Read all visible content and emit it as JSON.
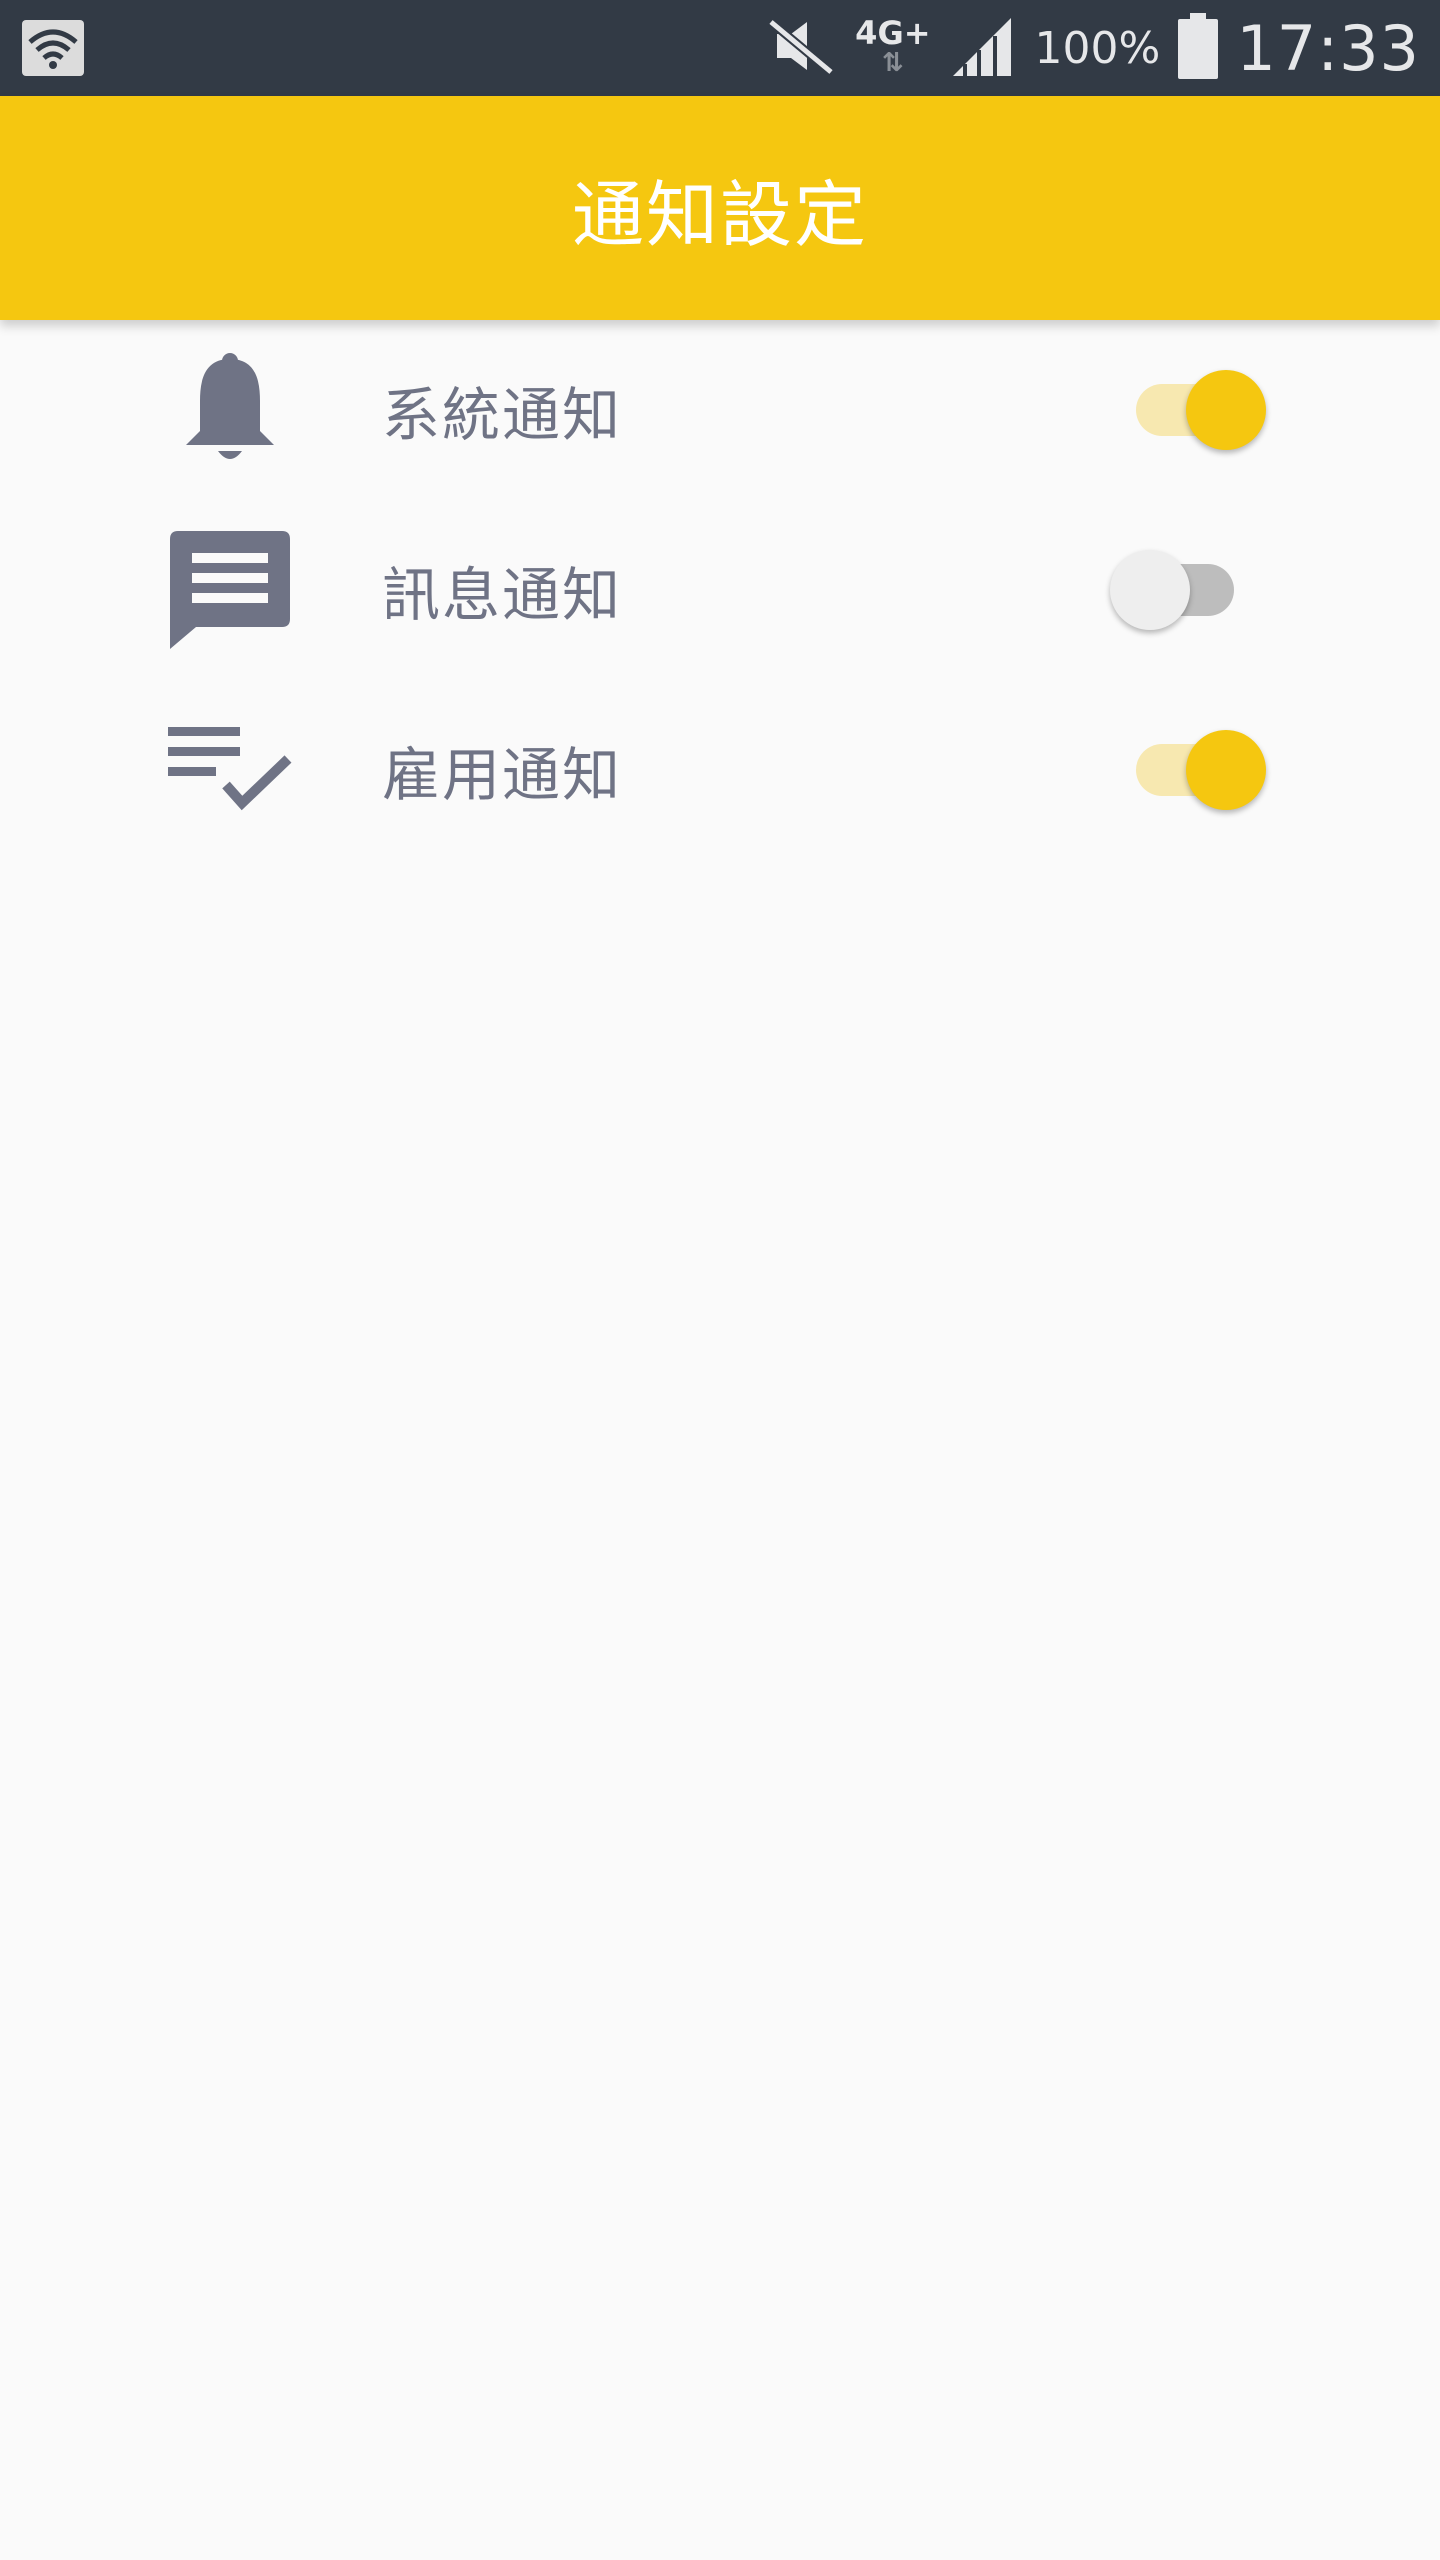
{
  "status_bar": {
    "network": "4G+",
    "battery_percent": "100%",
    "time": "17:33",
    "icons": [
      "wifi-icon",
      "mute-icon",
      "data-arrows-icon",
      "signal-icon",
      "battery-icon"
    ]
  },
  "app_bar": {
    "title": "通知設定",
    "background_color": "#f5c710"
  },
  "settings": [
    {
      "icon": "bell-icon",
      "label": "系統通知",
      "enabled": true
    },
    {
      "icon": "message-icon",
      "label": "訊息通知",
      "enabled": false
    },
    {
      "icon": "playlist-check-icon",
      "label": "雇用通知",
      "enabled": true
    }
  ],
  "colors": {
    "accent": "#f5c710",
    "icon": "#6f7385",
    "status_bar": "#323a45"
  }
}
